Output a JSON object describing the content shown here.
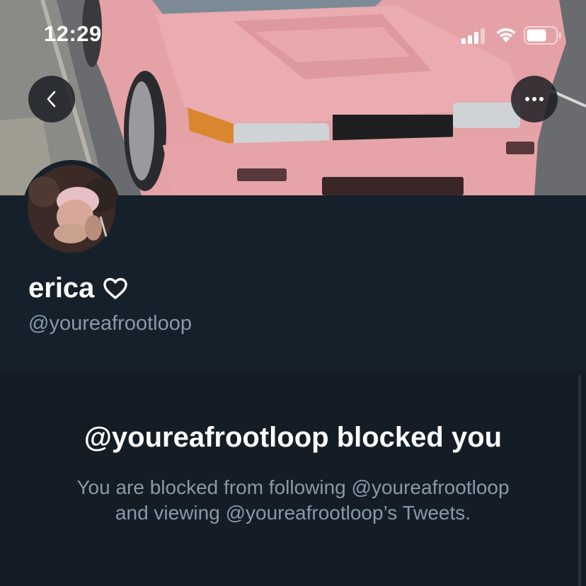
{
  "status_bar": {
    "time": "12:29",
    "signal_icon": "cellular-signal-icon",
    "wifi_icon": "wifi-icon",
    "battery_icon": "battery-icon"
  },
  "header": {
    "back_icon": "chevron-left-icon",
    "more_icon": "ellipsis-icon"
  },
  "profile": {
    "display_name": "erica",
    "name_icon": "heart-outline-icon",
    "handle": "@youreafrootloop"
  },
  "blocked": {
    "title": "@youreafrootloop blocked you",
    "line1": "You are blocked from following @youreafrootloop",
    "line2": "and viewing @youreafrootloop’s Tweets."
  },
  "colors": {
    "background": "#15202b",
    "secondary_text": "#8899a6",
    "car_pink": "#e8a5a8"
  }
}
